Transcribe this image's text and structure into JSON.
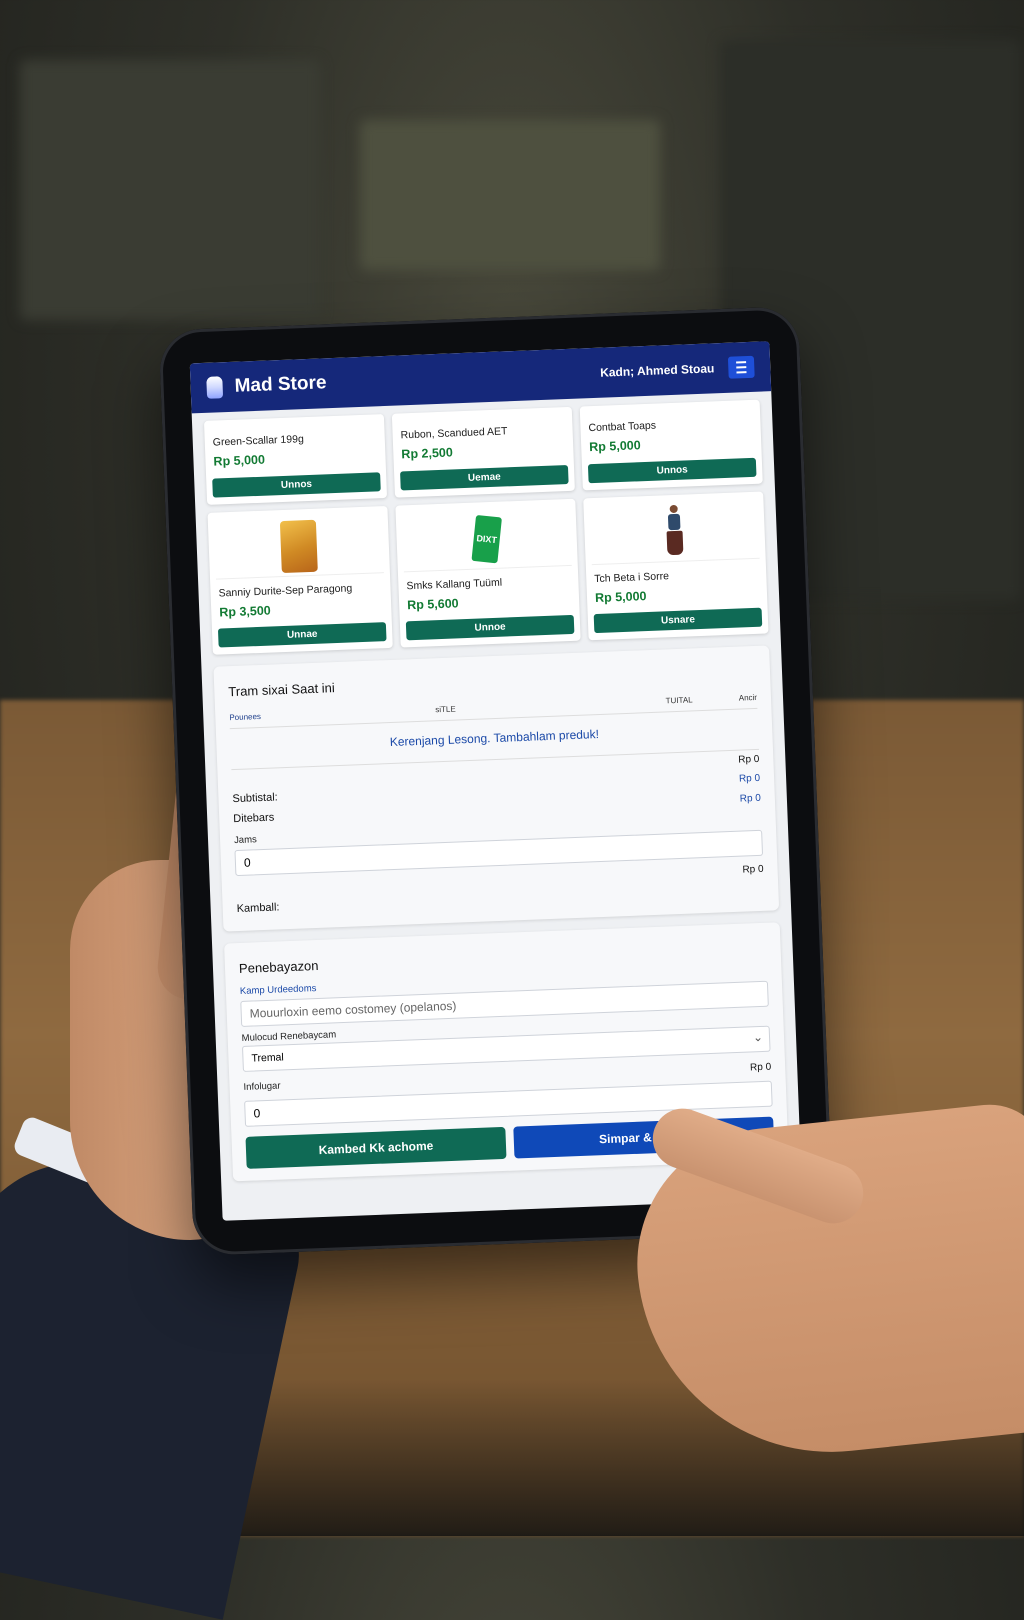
{
  "app": {
    "title": "Mad Store",
    "user": "Kadn; Ahmed Stoau",
    "logo_icon": "store-logo-icon",
    "menu_icon": "hamburger-menu-icon"
  },
  "products": [
    {
      "name": "Green-Scallar 199g",
      "price": "Rp 5,000",
      "button": "Unnos"
    },
    {
      "name": "Rubon, Scandued AET",
      "price": "Rp 2,500",
      "button": "Uemae"
    },
    {
      "name": "Contbat Toaps",
      "price": "Rp 5,000",
      "button": "Unnos"
    },
    {
      "name": "Sanniy Durite-Sep Paragong",
      "price": "Rp 3,500",
      "button": "Unnae",
      "image": "snack-bag-image"
    },
    {
      "name": "Smks Kallang Tuüml",
      "price": "Rp 5,600",
      "button": "Unnoe",
      "image": "green-card-image",
      "image_text": "DIXT"
    },
    {
      "name": "Tch Beta i Sorre",
      "price": "Rp 5,000",
      "button": "Usnare",
      "image": "figure-image"
    }
  ],
  "transaction": {
    "title": "Tram sixai Saat ini",
    "columns": [
      "Pounees",
      "siTLE",
      "TUITAL",
      "Ancir"
    ],
    "empty_message": "Kerenjang Lesong. Tambahlam preduk!",
    "total_top": "Rp 0",
    "subtotal_label": "Subtistal:",
    "subtotal_value": "Rp 0",
    "discount_label": "Ditebars",
    "discount_value": "Rp 0",
    "jams_label": "Jams",
    "input_value": "0",
    "kembali_value": "Rp 0",
    "kembali_label": "Kamball:"
  },
  "payment": {
    "title": "Penebayazon",
    "customer_label": "Kamp Urdeedoms",
    "customer_placeholder": "Mouurloxin eemo costomey (opelanos)",
    "method_label": "Mulocud Renebaycam",
    "method_value": "Tremal",
    "info_label": "Infolugar",
    "info_amount": "Rp 0",
    "info_value": "0",
    "button_secondary": "Kambed Kk achome",
    "button_primary": "Simpar & Creak",
    "colors": {
      "primary": "#0f49b8",
      "secondary": "#0f6a55",
      "topbar": "#15287a",
      "price": "#127a33"
    }
  }
}
